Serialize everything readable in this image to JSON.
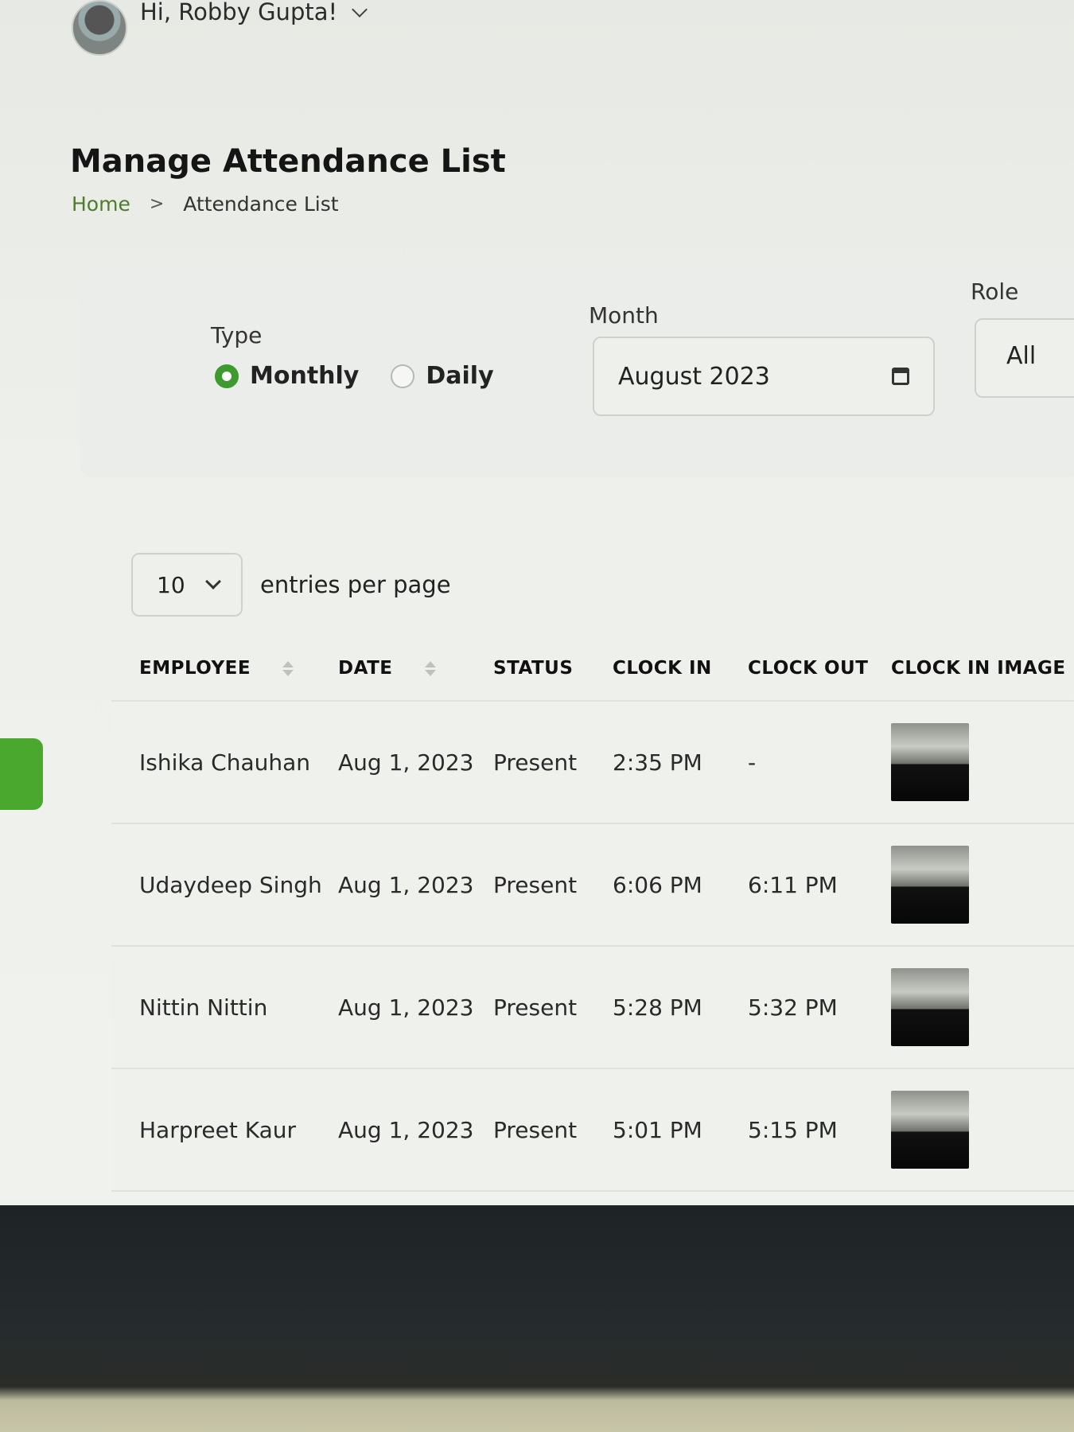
{
  "header": {
    "greeting": "Hi, Robby Gupta!"
  },
  "page": {
    "title": "Manage Attendance List",
    "breadcrumb": {
      "home": "Home",
      "separator": ">",
      "current": "Attendance List"
    }
  },
  "filters": {
    "type_label": "Type",
    "type_options": [
      {
        "label": "Monthly",
        "selected": true
      },
      {
        "label": "Daily",
        "selected": false
      }
    ],
    "month_label": "Month",
    "month_value": "August 2023",
    "role_label": "Role",
    "role_value": "All"
  },
  "entries": {
    "value": "10",
    "label": "entries per page"
  },
  "table": {
    "columns": [
      "EMPLOYEE",
      "DATE",
      "STATUS",
      "CLOCK IN",
      "CLOCK OUT",
      "CLOCK IN IMAGE"
    ],
    "rows": [
      {
        "employee": "Ishika Chauhan",
        "date": "Aug 1, 2023",
        "status": "Present",
        "clock_in": "2:35 PM",
        "clock_out": "-"
      },
      {
        "employee": "Udaydeep Singh",
        "date": "Aug 1, 2023",
        "status": "Present",
        "clock_in": "6:06 PM",
        "clock_out": "6:11 PM"
      },
      {
        "employee": "Nittin Nittin",
        "date": "Aug 1, 2023",
        "status": "Present",
        "clock_in": "5:28 PM",
        "clock_out": "5:32 PM"
      },
      {
        "employee": "Harpreet Kaur",
        "date": "Aug 1, 2023",
        "status": "Present",
        "clock_in": "5:01 PM",
        "clock_out": "5:15 PM"
      }
    ]
  },
  "colors": {
    "accent": "#3d9a2e",
    "link": "#4e7b2e",
    "side_tab": "#4aa82e"
  }
}
